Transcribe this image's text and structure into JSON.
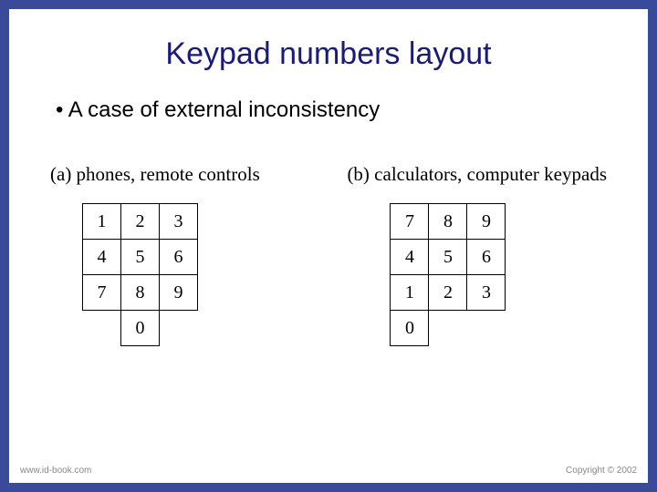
{
  "title": "Keypad numbers layout",
  "bullet": "A case of external inconsistency",
  "left": {
    "caption": "(a) phones, remote controls",
    "rows": [
      [
        "1",
        "2",
        "3"
      ],
      [
        "4",
        "5",
        "6"
      ],
      [
        "7",
        "8",
        "9"
      ]
    ],
    "zero": "0"
  },
  "right": {
    "caption": "(b) calculators, computer keypads",
    "rows": [
      [
        "7",
        "8",
        "9"
      ],
      [
        "4",
        "5",
        "6"
      ],
      [
        "1",
        "2",
        "3"
      ]
    ],
    "zero": "0"
  },
  "footer": {
    "left": "www.id-book.com",
    "right": "Copyright © 2002"
  }
}
